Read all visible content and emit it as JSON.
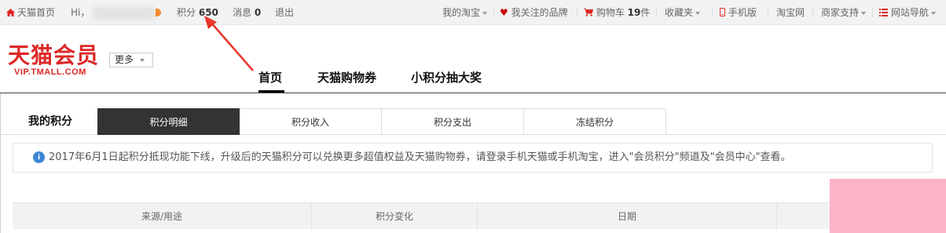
{
  "topbar": {
    "home": "天猫首页",
    "greeting": "Hi，",
    "points_label": "积分",
    "points_value": "650",
    "messages_label": "消息",
    "messages_value": "0",
    "logout": "退出",
    "my_taobao": "我的淘宝",
    "brands": "我关注的品牌",
    "cart_label": "购物车",
    "cart_count": "19",
    "cart_unit": "件",
    "favorites": "收藏夹",
    "mobile": "手机版",
    "taobao": "淘宝网",
    "seller_support": "商家支持",
    "site_nav": "网站导航"
  },
  "header": {
    "logo_cn": "天猫会员",
    "logo_en": "VIP.TMALL.COM",
    "more_button": "更多",
    "nav": [
      "首页",
      "天猫购物券",
      "小积分抽大奖"
    ]
  },
  "points": {
    "title": "我的积分",
    "tabs": [
      "积分明细",
      "积分收入",
      "积分支出",
      "冻结积分"
    ]
  },
  "notice": {
    "text": "2017年6月1日起积分抵现功能下线，升级后的天猫积分可以兑换更多超值权益及天猫购物券，请登录手机天猫或手机淘宝，进入\"会员积分\"频道及\"会员中心\"查看。"
  },
  "table": {
    "columns": [
      "来源/用途",
      "积分变化",
      "日期"
    ]
  },
  "colors": {
    "brand_red": "#dd2727",
    "info_blue": "#3a86d3",
    "arrow_red": "#e8372b",
    "active_tab": "#333333"
  }
}
